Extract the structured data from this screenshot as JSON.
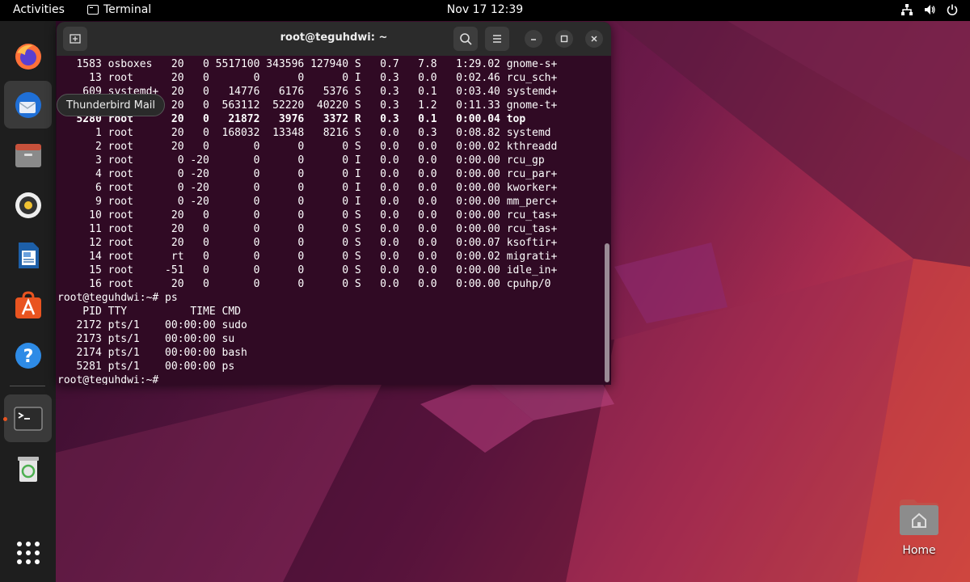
{
  "topbar": {
    "activities": "Activities",
    "app_name": "Terminal",
    "clock": "Nov 17  12:39"
  },
  "dock": {
    "items": [
      {
        "name": "Firefox",
        "icon": "firefox-icon"
      },
      {
        "name": "Thunderbird Mail",
        "icon": "thunderbird-icon"
      },
      {
        "name": "Files",
        "icon": "files-icon"
      },
      {
        "name": "Rhythmbox",
        "icon": "rhythmbox-icon"
      },
      {
        "name": "LibreOffice Writer",
        "icon": "writer-icon"
      },
      {
        "name": "Ubuntu Software",
        "icon": "software-icon"
      },
      {
        "name": "Help",
        "icon": "help-icon"
      },
      {
        "name": "Terminal",
        "icon": "terminal-icon"
      },
      {
        "name": "Trash",
        "icon": "trash-icon"
      },
      {
        "name": "Show Applications",
        "icon": "app-grid-icon"
      }
    ],
    "tooltip": "Thunderbird Mail"
  },
  "terminal": {
    "title": "root@teguhdwi: ~",
    "lines": [
      "   1583 osboxes   20   0 5517100 343596 127940 S   0.7   7.8   1:29.02 gnome-s+",
      "     13 root      20   0       0      0      0 I   0.3   0.0   0:02.46 rcu_sch+",
      "    609 systemd+  20   0   14776   6176   5376 S   0.3   0.1   0:03.40 systemd+",
      "   5201 osboxes   20   0  563112  52220  40220 S   0.3   1.2   0:11.33 gnome-t+",
      "   5280 root      20   0   21872   3976   3372 R   0.3   0.1   0:00.04 top",
      "      1 root      20   0  168032  13348   8216 S   0.0   0.3   0:08.82 systemd",
      "      2 root      20   0       0      0      0 S   0.0   0.0   0:00.02 kthreadd",
      "      3 root       0 -20       0      0      0 I   0.0   0.0   0:00.00 rcu_gp",
      "      4 root       0 -20       0      0      0 I   0.0   0.0   0:00.00 rcu_par+",
      "      6 root       0 -20       0      0      0 I   0.0   0.0   0:00.00 kworker+",
      "      9 root       0 -20       0      0      0 I   0.0   0.0   0:00.00 mm_perc+",
      "     10 root      20   0       0      0      0 S   0.0   0.0   0:00.00 rcu_tas+",
      "     11 root      20   0       0      0      0 S   0.0   0.0   0:00.00 rcu_tas+",
      "     12 root      20   0       0      0      0 S   0.0   0.0   0:00.07 ksoftir+",
      "     14 root      rt   0       0      0      0 S   0.0   0.0   0:00.02 migrati+",
      "     15 root     -51   0       0      0      0 S   0.0   0.0   0:00.00 idle_in+",
      "     16 root      20   0       0      0      0 S   0.0   0.0   0:00.00 cpuhp/0",
      "root@teguhdwi:~# ps",
      "    PID TTY          TIME CMD",
      "   2172 pts/1    00:00:00 sudo",
      "   2173 pts/1    00:00:00 su",
      "   2174 pts/1    00:00:00 bash",
      "   5281 pts/1    00:00:00 ps",
      "root@teguhdwi:~#"
    ],
    "bold_line_index": 4
  },
  "desktop": {
    "home_label": "Home"
  },
  "colors": {
    "terminal_bg": "#300a24",
    "accent": "#e95420"
  }
}
